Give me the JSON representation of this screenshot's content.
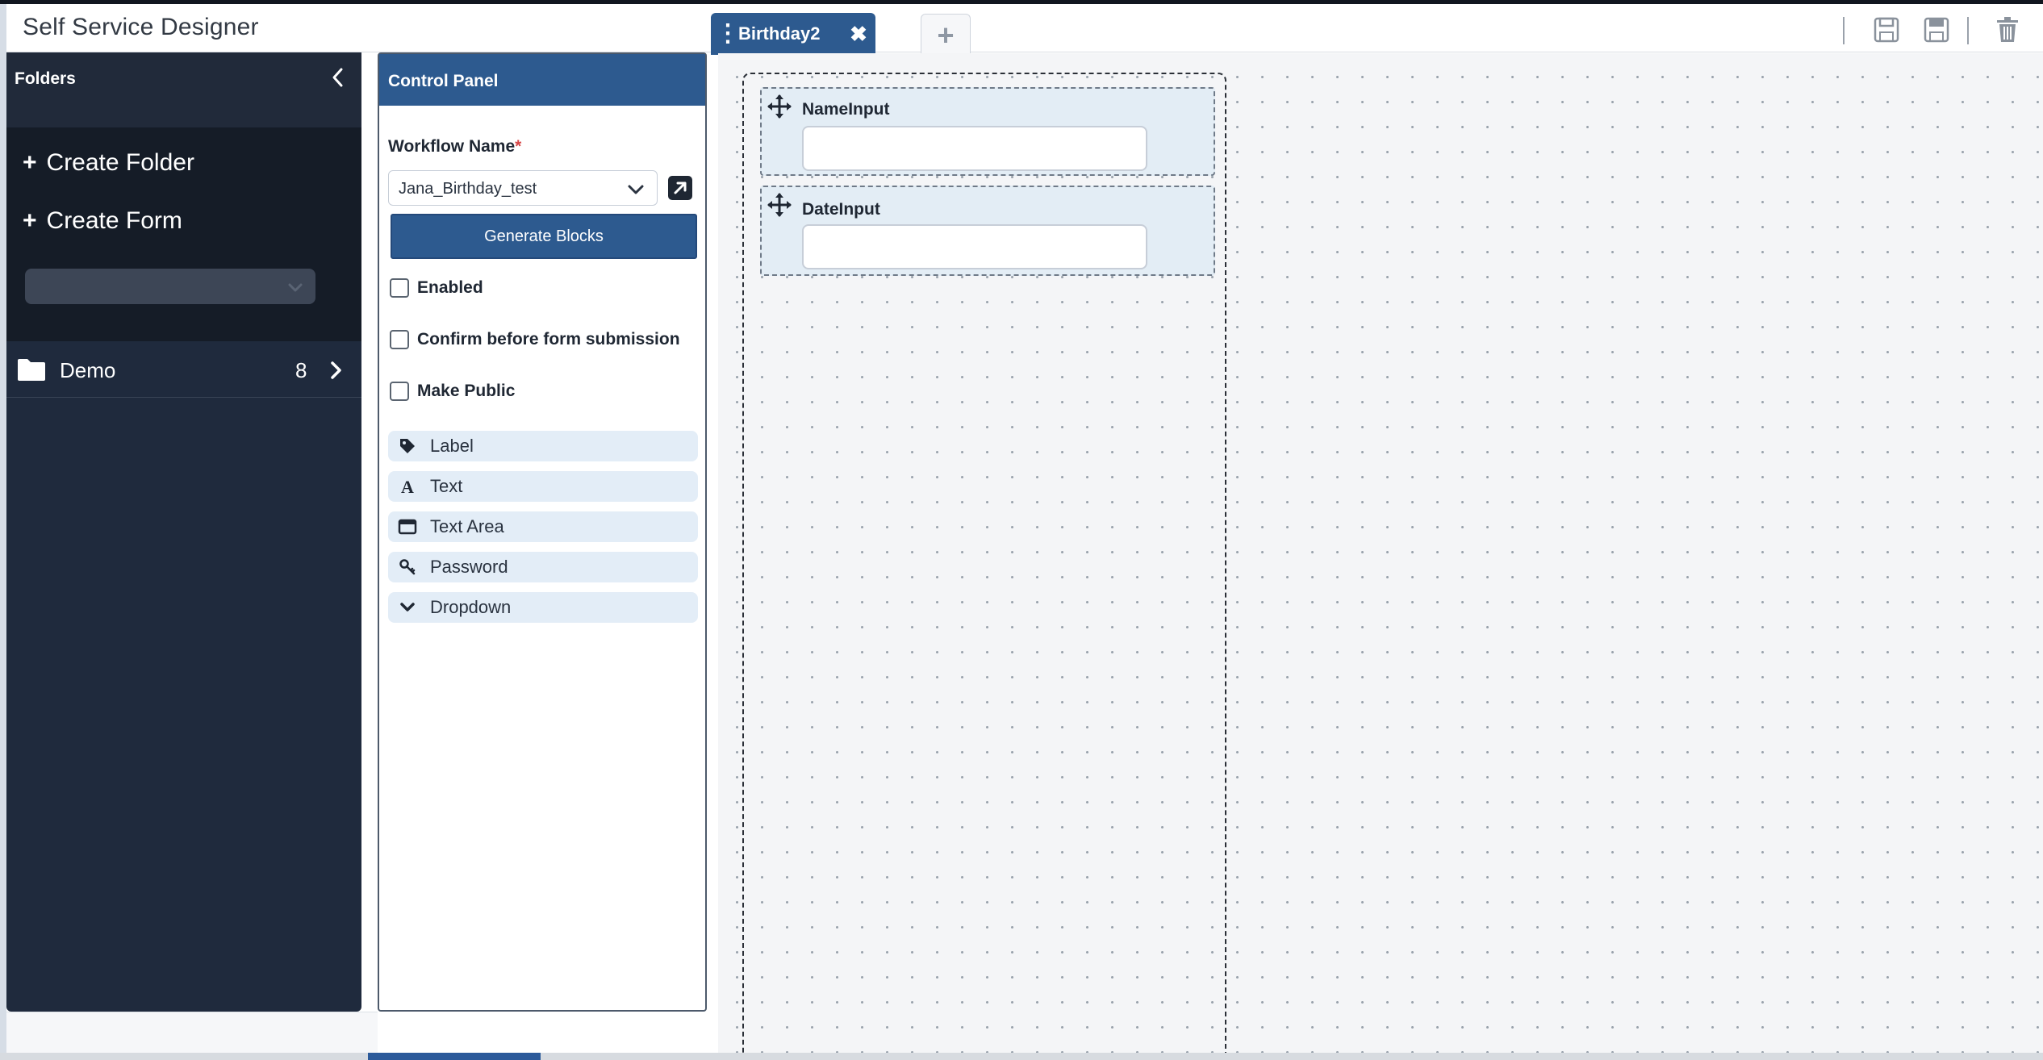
{
  "app": {
    "title": "Self Service Designer"
  },
  "tabs": {
    "active": {
      "label": "Birthday2",
      "grip": "⋮",
      "close": "✖"
    },
    "add": "+"
  },
  "header_icons": [
    "save-icon",
    "save-as-icon",
    "delete-icon"
  ],
  "sidebar": {
    "title": "Folders",
    "create_folder": "Create Folder",
    "create_form": "Create Form",
    "plus": "+",
    "select_value": "",
    "folders": [
      {
        "name": "Demo",
        "count": "8"
      }
    ]
  },
  "control_panel": {
    "title": "Control Panel",
    "workflow_label": "Workflow Name",
    "required_mark": "*",
    "workflow_value": "Jana_Birthday_test",
    "generate_button": "Generate Blocks",
    "checkboxes": [
      {
        "label": "Enabled",
        "checked": false
      },
      {
        "label": "Confirm before form submission",
        "checked": false
      },
      {
        "label": "Make Public",
        "checked": false
      }
    ],
    "controls": [
      {
        "label": "Label",
        "icon": "tag-icon"
      },
      {
        "label": "Text",
        "icon": "text-icon"
      },
      {
        "label": "Text Area",
        "icon": "textarea-icon"
      },
      {
        "label": "Password",
        "icon": "key-icon"
      },
      {
        "label": "Dropdown",
        "icon": "chevron-down-icon"
      }
    ]
  },
  "canvas": {
    "fields": [
      {
        "name": "NameInput",
        "value": ""
      },
      {
        "name": "DateInput",
        "value": ""
      }
    ]
  },
  "colors": {
    "primary": "#2d5a8f",
    "sidebar_bg": "#1f2a3d",
    "control_item_bg": "#e3edf7",
    "canvas_bg": "#f4f5f7"
  }
}
